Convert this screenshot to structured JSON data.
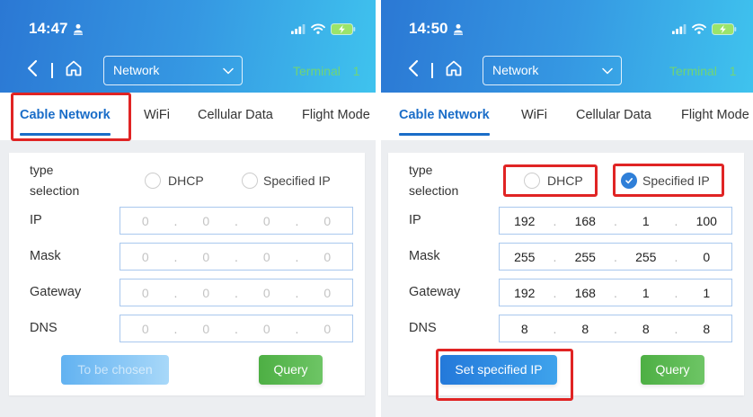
{
  "theme": {
    "header_gradient_start": "#2b78d4",
    "header_gradient_end": "#3fc3ee",
    "accent": "#1a6dc8",
    "query_green": "#52ba48",
    "terminal_green": "#7ddc5a",
    "annotation_red": "#e02424"
  },
  "panels": [
    {
      "status": {
        "time": "14:47"
      },
      "nav": {
        "icons": [
          "chevron-left-icon",
          "home-icon",
          "chevron-down-icon"
        ],
        "dropdown_value": "Network",
        "terminal": "Terminal 1"
      },
      "tabs": {
        "items": [
          "Cable Network",
          "WiFi",
          "Cellular Data",
          "Flight Mode"
        ],
        "active_index": 0
      },
      "form": {
        "type_label": "type selection",
        "options": [
          {
            "label": "DHCP",
            "checked": false
          },
          {
            "label": "Specified IP",
            "checked": false
          }
        ],
        "fields_disabled": true,
        "separator": ".",
        "rows": [
          {
            "label": "IP",
            "values": [
              "0",
              "0",
              "0",
              "0"
            ]
          },
          {
            "label": "Mask",
            "values": [
              "0",
              "0",
              "0",
              "0"
            ]
          },
          {
            "label": "Gateway",
            "values": [
              "0",
              "0",
              "0",
              "0"
            ]
          },
          {
            "label": "DNS",
            "values": [
              "0",
              "0",
              "0",
              "0"
            ]
          }
        ]
      },
      "buttons": {
        "primary": "To be chosen",
        "primary_disabled": true,
        "query": "Query"
      }
    },
    {
      "status": {
        "time": "14:50"
      },
      "nav": {
        "icons": [
          "chevron-left-icon",
          "home-icon",
          "chevron-down-icon"
        ],
        "dropdown_value": "Network",
        "terminal": "Terminal 1"
      },
      "tabs": {
        "items": [
          "Cable Network",
          "WiFi",
          "Cellular Data",
          "Flight Mode"
        ],
        "active_index": 0
      },
      "form": {
        "type_label": "type selection",
        "options": [
          {
            "label": "DHCP",
            "checked": false
          },
          {
            "label": "Specified IP",
            "checked": true
          }
        ],
        "fields_disabled": false,
        "separator": ".",
        "rows": [
          {
            "label": "IP",
            "values": [
              "192",
              "168",
              "1",
              "100"
            ]
          },
          {
            "label": "Mask",
            "values": [
              "255",
              "255",
              "255",
              "0"
            ]
          },
          {
            "label": "Gateway",
            "values": [
              "192",
              "168",
              "1",
              "1"
            ]
          },
          {
            "label": "DNS",
            "values": [
              "8",
              "8",
              "8",
              "8"
            ]
          }
        ]
      },
      "buttons": {
        "primary": "Set specified IP",
        "primary_disabled": false,
        "query": "Query"
      }
    }
  ]
}
